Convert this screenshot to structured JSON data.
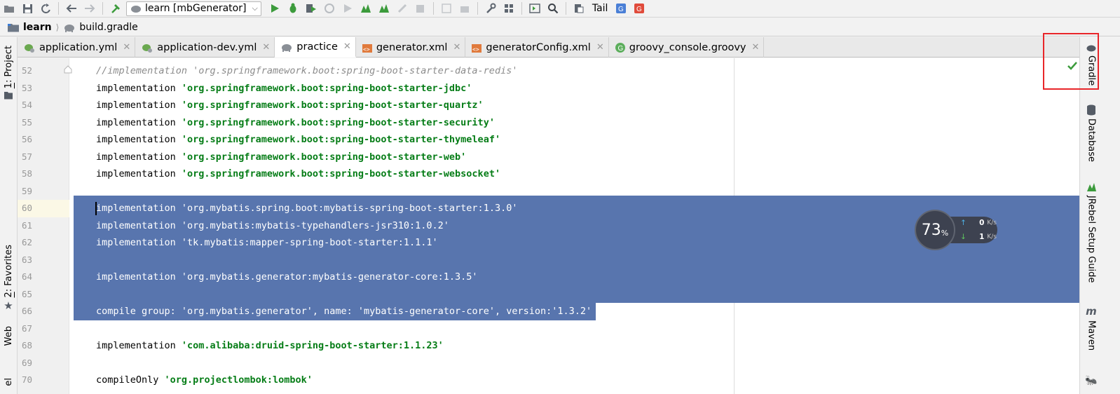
{
  "toolbar": {
    "run_config": "learn [mbGenerator]",
    "tail_label": "Tail"
  },
  "breadcrumb": {
    "project": "learn",
    "file": "build.gradle"
  },
  "left_tools": [
    {
      "num": "1",
      "label": "Project"
    },
    {
      "num": "2",
      "label": "Favorites"
    },
    {
      "label": "Web"
    },
    {
      "label": "el"
    }
  ],
  "right_tools": [
    {
      "label": "Gradle"
    },
    {
      "label": "Database"
    },
    {
      "label": "JRebel Setup Guide"
    },
    {
      "label": "Maven"
    }
  ],
  "tabs": [
    {
      "label": "application.yml",
      "icon": "spring-leaf-icon",
      "active": false
    },
    {
      "label": "application-dev.yml",
      "icon": "spring-leaf-icon",
      "active": false
    },
    {
      "label": "practice",
      "icon": "gradle-elephant-icon",
      "active": true
    },
    {
      "label": "generator.xml",
      "icon": "xml-file-icon",
      "active": false
    },
    {
      "label": "generatorConfig.xml",
      "icon": "xml-file-icon",
      "active": false
    },
    {
      "label": "groovy_console.groovy",
      "icon": "groovy-g-icon",
      "active": false
    }
  ],
  "code": {
    "lines": [
      {
        "n": "52",
        "parts": [
          {
            "t": "//implementation 'org.springframework.boot:spring-boot-starter-data-redis'",
            "c": "comment"
          }
        ]
      },
      {
        "n": "53",
        "parts": [
          {
            "t": "implementation ",
            "c": "kw"
          },
          {
            "t": "'org.springframework.boot:spring-boot-starter-jdbc'",
            "c": "str"
          }
        ]
      },
      {
        "n": "54",
        "parts": [
          {
            "t": "implementation ",
            "c": "kw"
          },
          {
            "t": "'org.springframework.boot:spring-boot-starter-quartz'",
            "c": "str"
          }
        ]
      },
      {
        "n": "55",
        "parts": [
          {
            "t": "implementation ",
            "c": "kw"
          },
          {
            "t": "'org.springframework.boot:spring-boot-starter-security'",
            "c": "str"
          }
        ]
      },
      {
        "n": "56",
        "parts": [
          {
            "t": "implementation ",
            "c": "kw"
          },
          {
            "t": "'org.springframework.boot:spring-boot-starter-thymeleaf'",
            "c": "str"
          }
        ]
      },
      {
        "n": "57",
        "parts": [
          {
            "t": "implementation ",
            "c": "kw"
          },
          {
            "t": "'org.springframework.boot:spring-boot-starter-web'",
            "c": "str"
          }
        ]
      },
      {
        "n": "58",
        "parts": [
          {
            "t": "implementation ",
            "c": "kw"
          },
          {
            "t": "'org.springframework.boot:spring-boot-starter-websocket'",
            "c": "str"
          }
        ]
      },
      {
        "n": "59",
        "parts": []
      },
      {
        "n": "60",
        "parts": [
          {
            "t": "implementation ",
            "c": "kw"
          },
          {
            "t": "'org.mybatis.spring.boot:mybatis-spring-boot-starter:1.3.0'",
            "c": "str"
          }
        ],
        "sel": true
      },
      {
        "n": "61",
        "parts": [
          {
            "t": "implementation ",
            "c": "kw"
          },
          {
            "t": "'org.mybatis:mybatis-typehandlers-jsr310:1.0.2'",
            "c": "str"
          }
        ],
        "sel": true
      },
      {
        "n": "62",
        "parts": [
          {
            "t": "implementation ",
            "c": "kw"
          },
          {
            "t": "'tk.mybatis:mapper-spring-boot-starter:1.1.1'",
            "c": "str"
          }
        ],
        "sel": true
      },
      {
        "n": "63",
        "parts": [],
        "sel": true
      },
      {
        "n": "64",
        "parts": [
          {
            "t": "implementation ",
            "c": "kw"
          },
          {
            "t": "'org.mybatis.generator:mybatis-generator-core:1.3.5'",
            "c": "str"
          }
        ],
        "sel": true
      },
      {
        "n": "65",
        "parts": [],
        "sel": true
      },
      {
        "n": "66",
        "parts": [
          {
            "t": "compile group: ",
            "c": "kw"
          },
          {
            "t": "'org.mybatis.generator'",
            "c": "str"
          },
          {
            "t": ", name: ",
            "c": "kw"
          },
          {
            "t": "'mybatis-generator-core'",
            "c": "str"
          },
          {
            "t": ", version:",
            "c": "kw"
          },
          {
            "t": "'1.3.2'",
            "c": "str"
          }
        ],
        "sel": true
      },
      {
        "n": "67",
        "parts": []
      },
      {
        "n": "68",
        "parts": [
          {
            "t": "implementation ",
            "c": "kw"
          },
          {
            "t": "'com.alibaba:druid-spring-boot-starter:1.1.23'",
            "c": "str"
          }
        ]
      },
      {
        "n": "69",
        "parts": []
      },
      {
        "n": "70",
        "parts": [
          {
            "t": "compileOnly ",
            "c": "kw"
          },
          {
            "t": "'org.projectlombok:lombok'",
            "c": "str"
          }
        ]
      }
    ]
  },
  "net_widget": {
    "percent": "73",
    "percent_sign": "%",
    "up_value": "0",
    "down_value": "1",
    "unit": "K/s"
  },
  "colors": {
    "selection": "#5875ae",
    "string": "#067d17",
    "comment": "#8c8c8c",
    "highlight": "#e8262a",
    "run_green": "#3c9b3c"
  }
}
